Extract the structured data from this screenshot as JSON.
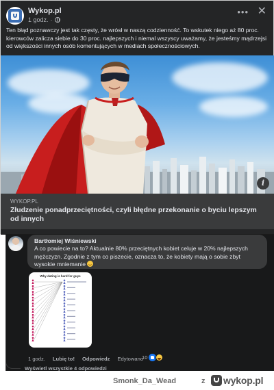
{
  "post": {
    "page_name": "Wykop.pl",
    "time": "1 godz.",
    "text": "Ten błąd poznawczy jest tak częsty, że wrósł w naszą codzienność. To wskutek niego aż 80 proc. kierowców zalicza siebie do 30 proc. najlepszych i niemal wszyscy uważamy, że jesteśmy mądrzejsi od większości innych osób komentujących w mediach społecznościowych.",
    "link": {
      "domain": "WYKOP.PL",
      "title": "Złudzenie ponadprzeciętności, czyli błędne przekonanie o byciu lepszym od innych"
    },
    "icons": {
      "more": "more-icon",
      "close": "close-icon",
      "info": "info-icon",
      "audience": "globe-icon"
    }
  },
  "comment": {
    "author": "Bartłomiej Wiśniewski",
    "text": "A co powiecie na to? Aktualnie 80% przeciętnych kobiet celuje w 20% najlepszych mężczyzn. Zgodnie z tym co piszecie, oznacza to, że kobiety mają o sobie zbyt wysokie mniemanie",
    "attachment_title": "Why dating is hard for guys",
    "actions": {
      "time": "1 godz.",
      "like": "Lubię to!",
      "reply": "Odpowiedz",
      "edited": "Edytowano"
    },
    "reactions_count": "10",
    "view_replies": "Wyświetl wszystkie 4 odpowiedzi"
  },
  "footer": {
    "username": "Smonk_Da_Wead",
    "z": "z",
    "brand": "wykop.pl"
  },
  "colors": {
    "card_bg": "#242526",
    "bubble_bg": "#3a3b3c",
    "thread_bg": "#18191a",
    "text_primary": "#e4e6eb",
    "text_secondary": "#b0b3b8",
    "like_blue": "#1877f2",
    "meme_female": "#c2185b",
    "meme_male": "#5c6bc0"
  }
}
